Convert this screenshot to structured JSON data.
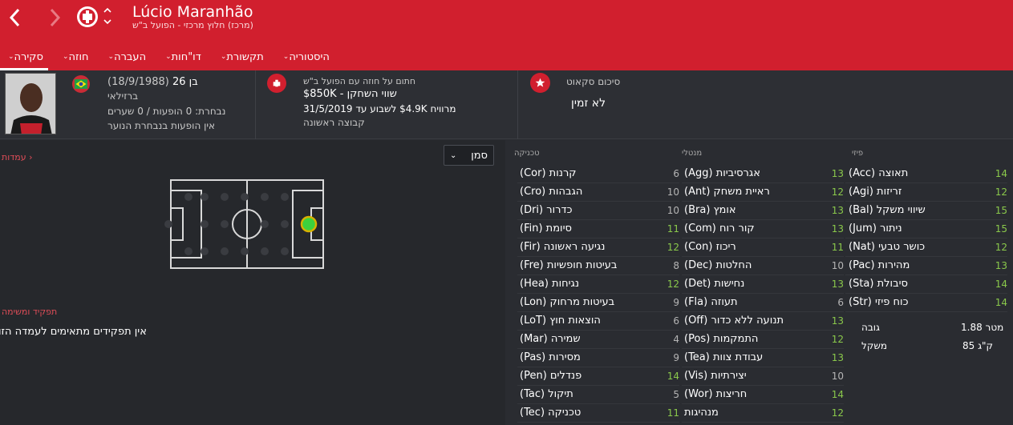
{
  "header": {
    "player_name": "Lúcio Maranhão",
    "player_sub": "(מרכז) חלוץ מרכזי - הפועל ב\"ש",
    "tabs": [
      {
        "label": "סקירה",
        "active": true
      },
      {
        "label": "חוזה"
      },
      {
        "label": "העברה"
      },
      {
        "label": "דו\"חות"
      },
      {
        "label": "תקשורת"
      },
      {
        "label": "היסטוריה"
      }
    ]
  },
  "info": {
    "age": "בן 26",
    "dob": "(18/9/1988)",
    "nationality": "ברזילאי",
    "national_team": "נבחרת: 0 הופעות / 0 שערים",
    "youth_team": "אין הופעות בנבחרת הנוער",
    "contract_label": "חתום על חוזה עם הפועל ב\"ש",
    "value_line": "שווי השחקן - $850K",
    "wage_line": "מרוויח $4.9K לשבוע עד 31/5/2019",
    "squad_status": "קבוצה ראשונה",
    "scout_label": "סיכום סקאוט",
    "scout_value": "לא זמין"
  },
  "left": {
    "positions_link": "עמדות",
    "select_value": "סמן",
    "role_title": "תפקיד ומשימה",
    "role_text": "אין תפקידים מתאימים לעמדה הזו"
  },
  "attributes": {
    "technical": {
      "title": "טכניקה",
      "items": [
        {
          "label": "קרנות (Cor)",
          "value": "6"
        },
        {
          "label": "הגבהות (Cro)",
          "value": "10"
        },
        {
          "label": "כדרור (Dri)",
          "value": "10"
        },
        {
          "label": "סיומת (Fin)",
          "value": "11"
        },
        {
          "label": "נגיעה ראשונה (Fir)",
          "value": "12"
        },
        {
          "label": "בעיטות חופשיות (Fre)",
          "value": "8"
        },
        {
          "label": "נגיחות (Hea)",
          "value": "12"
        },
        {
          "label": "בעיטות מרחוק (Lon)",
          "value": "9"
        },
        {
          "label": "הוצאות חוץ (LoT)",
          "value": "6"
        },
        {
          "label": "שמירה (Mar)",
          "value": "4"
        },
        {
          "label": "מסירות (Pas)",
          "value": "9"
        },
        {
          "label": "פנדלים (Pen)",
          "value": "14"
        },
        {
          "label": "תיקול (Tac)",
          "value": "5"
        },
        {
          "label": "טכניקה (Tec)",
          "value": "11"
        }
      ]
    },
    "mental": {
      "title": "מנטלי",
      "items": [
        {
          "label": "אגרסיביות (Agg)",
          "value": "13"
        },
        {
          "label": "ראיית משחק (Ant)",
          "value": "12"
        },
        {
          "label": "אומץ (Bra)",
          "value": "13"
        },
        {
          "label": "קור רוח (Com)",
          "value": "13"
        },
        {
          "label": "ריכוז (Con)",
          "value": "11"
        },
        {
          "label": "החלטות (Dec)",
          "value": "10"
        },
        {
          "label": "נחישות (Det)",
          "value": "13"
        },
        {
          "label": "תעוזה (Fla)",
          "value": "6"
        },
        {
          "label": "תנועה ללא כדור (Off)",
          "value": "13"
        },
        {
          "label": "התמקמות (Pos)",
          "value": "12"
        },
        {
          "label": "עבודת צוות (Tea)",
          "value": "13"
        },
        {
          "label": "יצירתיות (Vis)",
          "value": "10"
        },
        {
          "label": "חריצות (Wor)",
          "value": "14"
        },
        {
          "label": "מנהיגות",
          "value": "12"
        }
      ]
    },
    "physical": {
      "title": "פיזי",
      "items": [
        {
          "label": "תאוצה (Acc)",
          "value": "14"
        },
        {
          "label": "זריזות (Agi)",
          "value": "12"
        },
        {
          "label": "שיווי משקל (Bal)",
          "value": "15"
        },
        {
          "label": "ניתור (Jum)",
          "value": "15"
        },
        {
          "label": "כושר טבעי (Nat)",
          "value": "12"
        },
        {
          "label": "מהירות (Pac)",
          "value": "13"
        },
        {
          "label": "סיבולת (Sta)",
          "value": "14"
        },
        {
          "label": "כוח פיזי (Str)",
          "value": "14"
        }
      ],
      "height_label": "גובה",
      "height_value": "1.88 מטר",
      "weight_label": "משקל",
      "weight_value": "85 ק\"ג"
    }
  },
  "colors": {
    "header_red": "#d11f2e",
    "attr_green": "#8ac84b",
    "attr_gray": "#b5b5b5"
  }
}
